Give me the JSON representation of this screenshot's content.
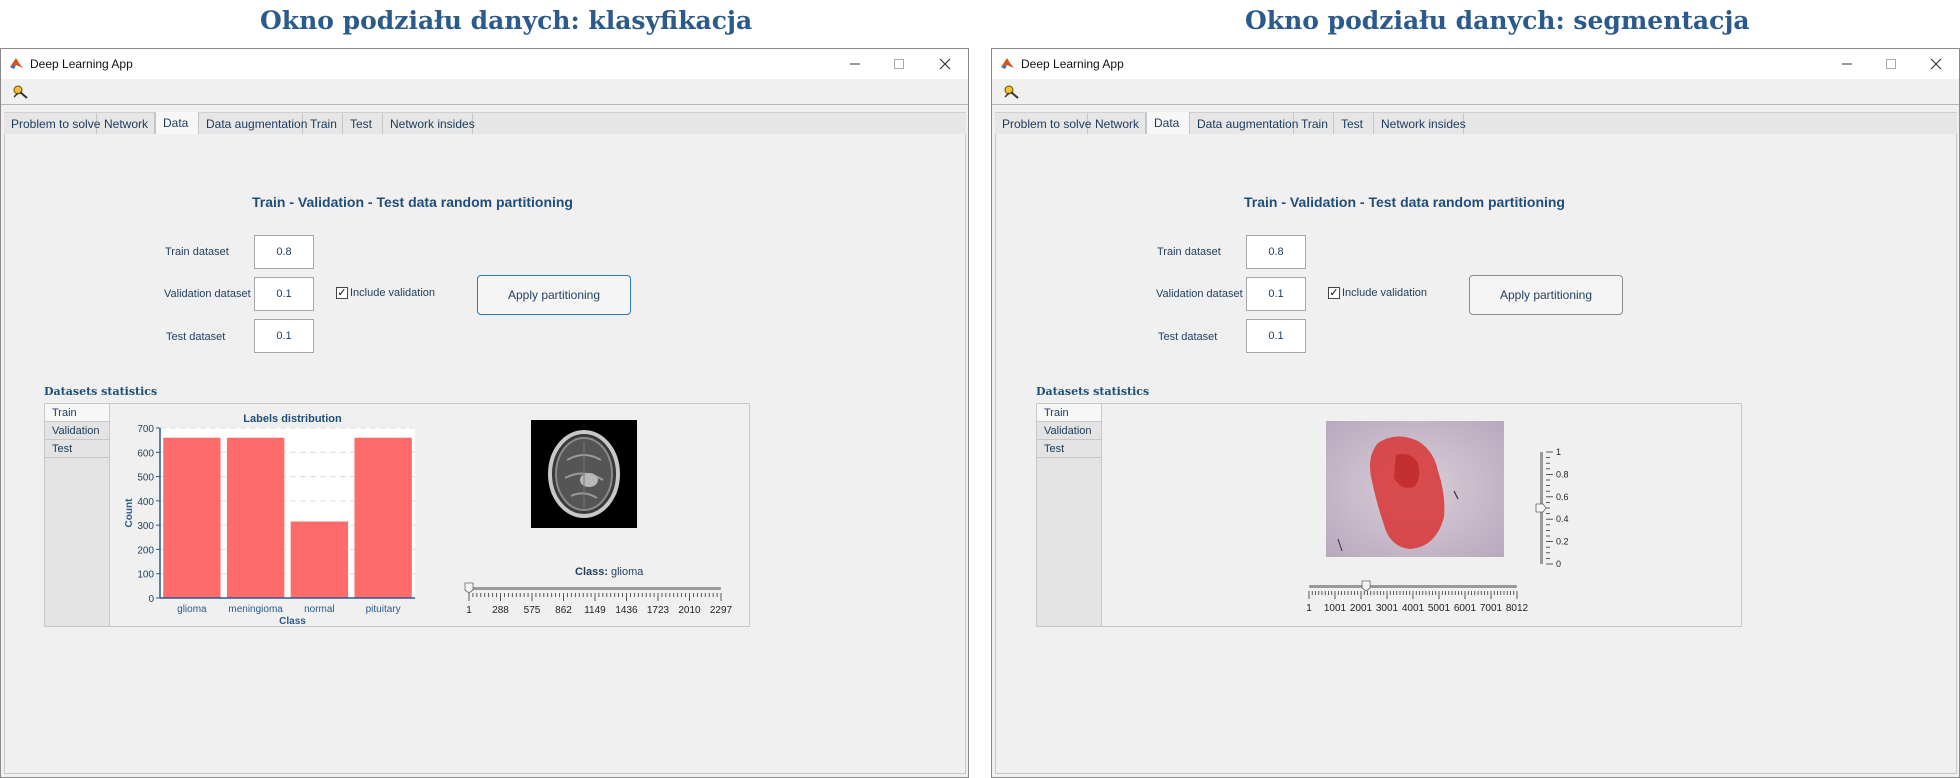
{
  "headings": {
    "left": "Okno podziału danych: klasyfikacja",
    "right": "Okno podziału danych: segmentacja"
  },
  "colors": {
    "accent": "#2b5a8c",
    "bar_fill": "#ff6b6b",
    "label": "#1e3e5e"
  },
  "windows": [
    {
      "title": "Deep Learning App",
      "tabs": [
        "Problem to solve",
        "Network",
        "Data",
        "Data augmentation",
        "Train",
        "Test",
        "Network insides"
      ],
      "active_tab": "Data",
      "partition_title": "Train - Validation - Test data random partitioning",
      "train_label": "Train dataset",
      "train_value": "0.8",
      "validation_label": "Validation dataset",
      "validation_value": "0.1",
      "test_label": "Test dataset",
      "test_value": "0.1",
      "include_validation": "Include validation",
      "apply_button": "Apply partitioning",
      "stats_title": "Datasets statistics",
      "stats_tabs": [
        "Train",
        "Validation",
        "Test"
      ],
      "image_class_label": "Class:",
      "image_class_value": "glioma",
      "slider_value": 1,
      "slider_ticks": [
        "1",
        "288",
        "575",
        "862",
        "1149",
        "1436",
        "1723",
        "2010",
        "2297"
      ]
    },
    {
      "title": "Deep Learning App",
      "tabs": [
        "Problem to solve",
        "Network",
        "Data",
        "Data augmentation",
        "Train",
        "Test",
        "Network insides"
      ],
      "active_tab": "Data",
      "partition_title": "Train - Validation - Test data random partitioning",
      "train_label": "Train dataset",
      "train_value": "0.8",
      "validation_label": "Validation dataset",
      "validation_value": "0.1",
      "test_label": "Test dataset",
      "test_value": "0.1",
      "include_validation": "Include validation",
      "apply_button": "Apply partitioning",
      "stats_title": "Datasets statistics",
      "stats_tabs": [
        "Train",
        "Validation",
        "Test"
      ],
      "slider_value": 2200,
      "slider_ticks": [
        "1",
        "1001",
        "2001",
        "3001",
        "4001",
        "5001",
        "6001",
        "7001",
        "8012"
      ],
      "opacity_ticks": [
        "1",
        "0.8",
        "0.6",
        "0.4",
        "0.2",
        "0"
      ],
      "opacity_value": 0.5
    }
  ],
  "chart_data": {
    "type": "bar",
    "title": "Labels  distribution",
    "xlabel": "Class",
    "ylabel": "Count",
    "categories": [
      "glioma",
      "meningioma",
      "normal",
      "pituitary"
    ],
    "values": [
      660,
      660,
      315,
      660
    ],
    "ylim": [
      0,
      700
    ],
    "yticks": [
      "0",
      "100",
      "200",
      "300",
      "400",
      "500",
      "600",
      "700"
    ],
    "grid": true
  }
}
